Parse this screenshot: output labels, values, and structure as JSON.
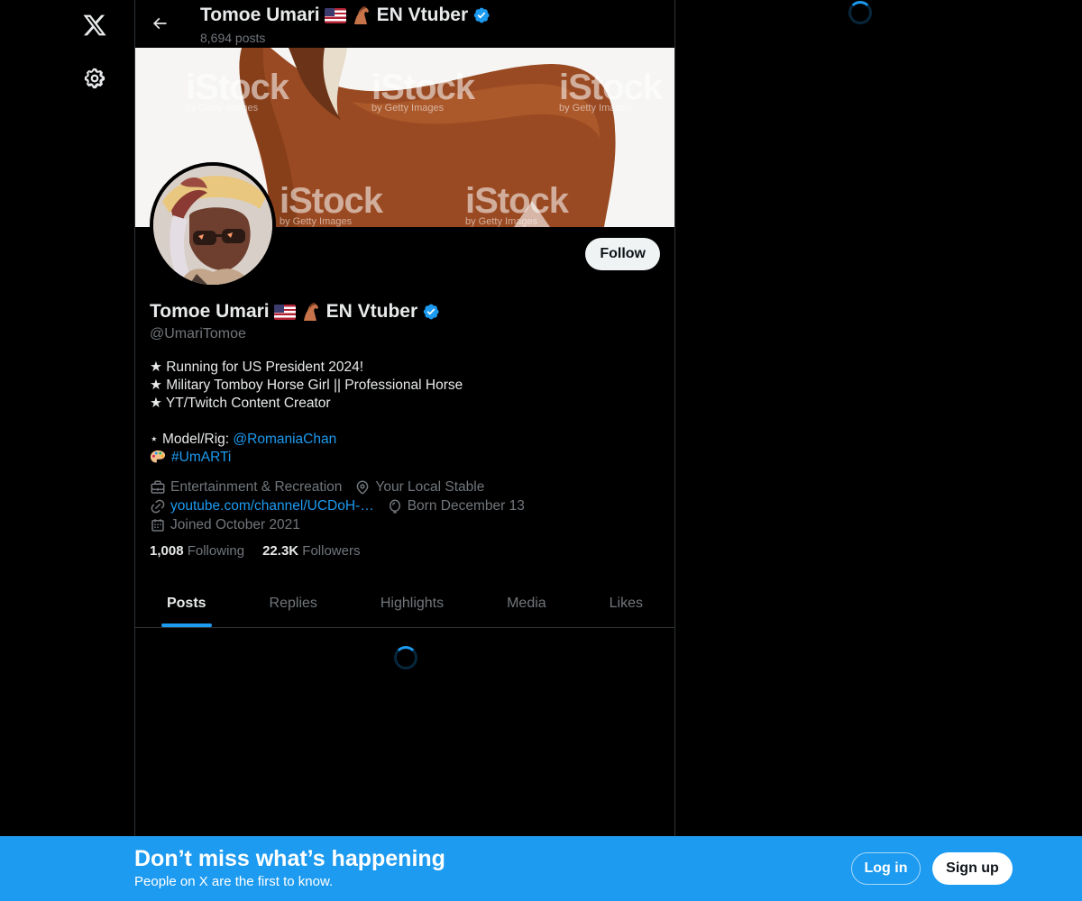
{
  "header": {
    "title": "Tomoe Umari",
    "title_suffix": "EN Vtuber",
    "post_count": "8,694 posts"
  },
  "banner": {
    "watermark": "iStock",
    "watermark_sub": "by Getty Images"
  },
  "profile": {
    "name": "Tomoe Umari",
    "name_suffix": "EN Vtuber",
    "handle": "@UmariTomoe",
    "follow_label": "Follow",
    "bio": {
      "line1": "★ Running for US President 2024!",
      "line2": "★ Military Tomboy Horse Girl || Professional Horse",
      "line3": "★ YT/Twitch Content Creator",
      "model_prefix": "⋆ Model/Rig: ",
      "model_link": "@RomaniaChan",
      "hashtag": "#UmARTi"
    },
    "meta": {
      "category": "Entertainment & Recreation",
      "location": "Your Local Stable",
      "website": "youtube.com/channel/UCDoH-…",
      "birthday": "Born December 13",
      "joined": "Joined October 2021"
    },
    "stats": {
      "following_count": "1,008",
      "following_label": "Following",
      "followers_count": "22.3K",
      "followers_label": "Followers"
    }
  },
  "tabs": [
    "Posts",
    "Replies",
    "Highlights",
    "Media",
    "Likes"
  ],
  "bottom_bar": {
    "title": "Don’t miss what’s happening",
    "subtitle": "People on X are the first to know.",
    "login_label": "Log in",
    "signup_label": "Sign up"
  },
  "colors": {
    "accent": "#1d9bf0",
    "background": "#000000",
    "muted_text": "#71767b"
  },
  "icons": [
    "x-logo-icon",
    "gear-icon",
    "back-arrow-icon",
    "verified-badge-icon",
    "us-flag-icon",
    "horse-icon",
    "briefcase-icon",
    "location-pin-icon",
    "link-icon",
    "balloon-icon",
    "calendar-icon",
    "palette-icon",
    "loading-spinner-icon"
  ]
}
